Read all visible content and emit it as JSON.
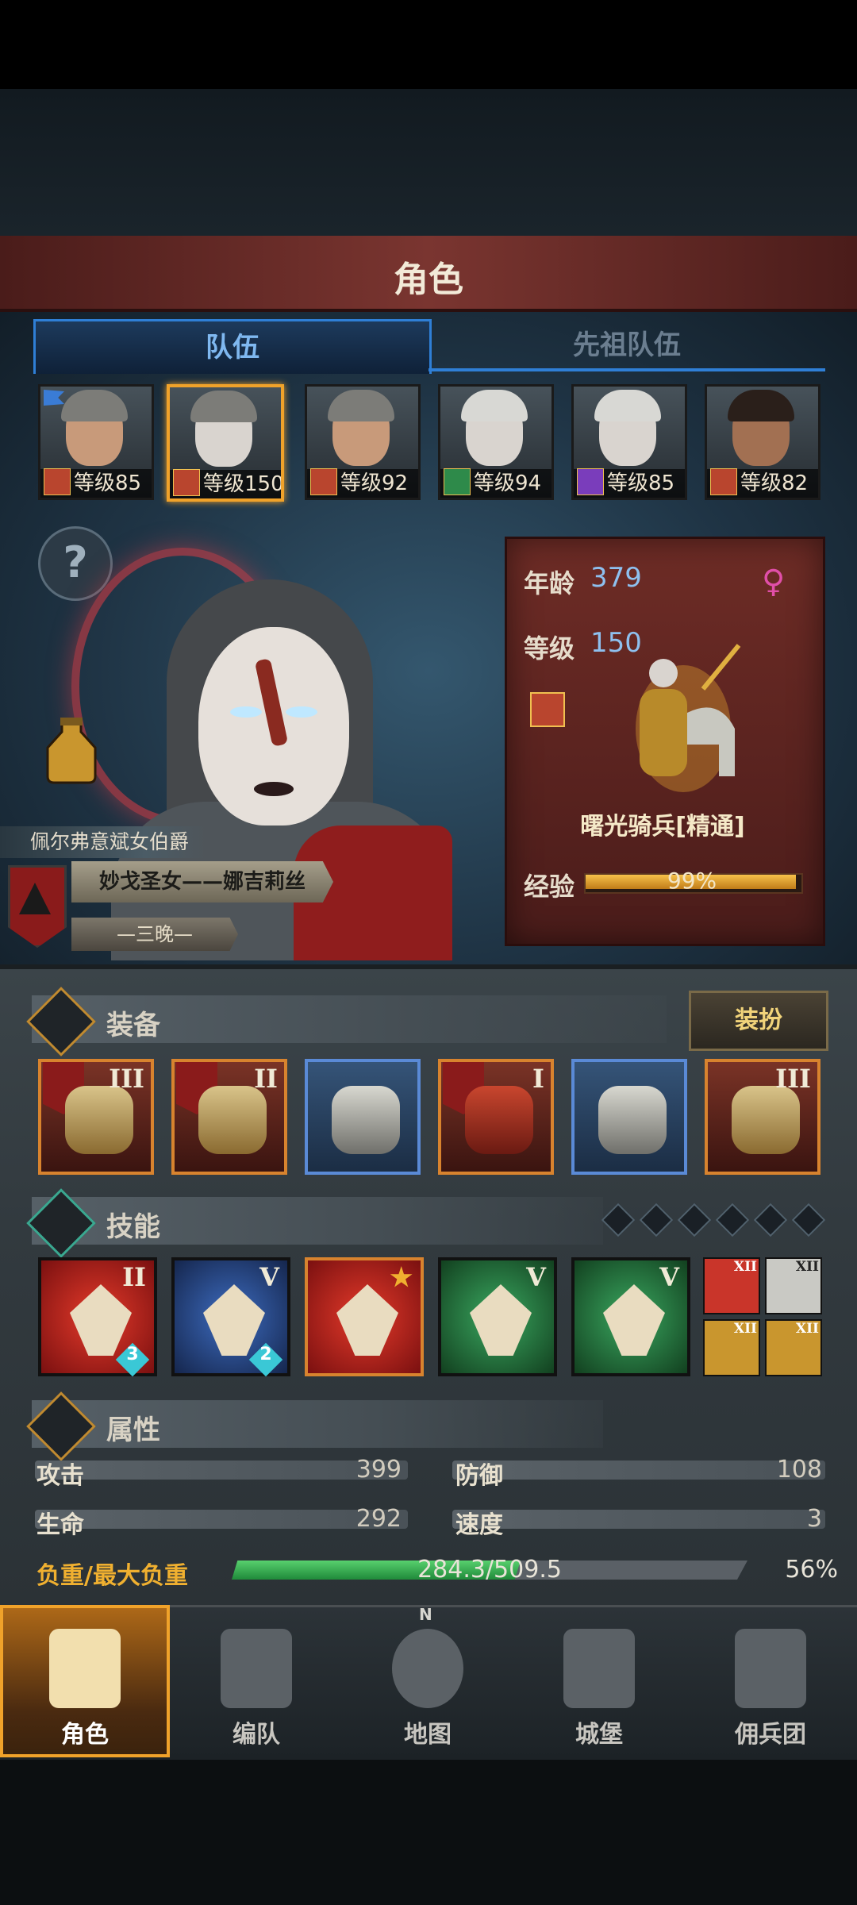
{
  "header": {
    "title": "角色"
  },
  "tabs": {
    "team": "队伍",
    "ancestor": "先祖队伍"
  },
  "party": [
    {
      "level": "等级85"
    },
    {
      "level": "等级150"
    },
    {
      "level": "等级92"
    },
    {
      "level": "等级94"
    },
    {
      "level": "等级85"
    },
    {
      "level": "等级82"
    }
  ],
  "hero": {
    "title": "佩尔弗意斌女伯爵",
    "name": "妙戈圣女——娜吉莉丝",
    "subtitle": "—三晚—",
    "help_icon": "?"
  },
  "info": {
    "age_label": "年龄",
    "age_value": "379",
    "level_label": "等级",
    "level_value": "150",
    "class_name": "曙光骑兵[精通]",
    "exp_label": "经验",
    "exp_text": "99%",
    "exp_fraction": 0.99,
    "gender_icon": "female-icon"
  },
  "equipment": {
    "title": "装备",
    "dress_button": "装扮",
    "slots": [
      {
        "rank": "III"
      },
      {
        "rank": "II"
      },
      {
        "rank": ""
      },
      {
        "rank": "I"
      },
      {
        "rank": ""
      },
      {
        "rank": "III"
      }
    ]
  },
  "skills": {
    "title": "技能",
    "items": [
      {
        "rank": "II",
        "gem": "3"
      },
      {
        "rank": "V",
        "gem": "2"
      },
      {
        "rank": "★",
        "gem": ""
      },
      {
        "rank": "V",
        "gem": ""
      },
      {
        "rank": "V",
        "gem": ""
      }
    ],
    "mini": [
      {
        "rank": "XII"
      },
      {
        "rank": "XII"
      },
      {
        "rank": "XII"
      },
      {
        "rank": "XII"
      }
    ]
  },
  "attributes": {
    "title": "属性",
    "attack_label": "攻击",
    "attack_value": "399",
    "defense_label": "防御",
    "defense_value": "108",
    "hp_label": "生命",
    "hp_value": "292",
    "speed_label": "速度",
    "speed_value": "3",
    "load_label": "负重/最大负重",
    "load_text": "284.3/509.5",
    "load_pct": "56%",
    "load_fraction": 0.56
  },
  "nav": {
    "character": "角色",
    "formation": "编队",
    "map": "地图",
    "castle": "城堡",
    "mercenary": "佣兵团",
    "compass_n": "N"
  },
  "colors": {
    "accent_orange": "#f0a22a",
    "accent_blue": "#2f7fd6",
    "load_green": "#2fb04d",
    "header_red": "#7a3530"
  }
}
